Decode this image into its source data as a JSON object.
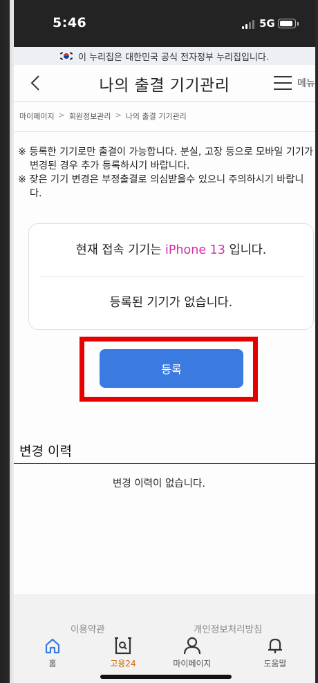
{
  "status_bar": {
    "time": "5:46",
    "network": "5G"
  },
  "gov_banner": {
    "text": "이 누리집은 대한민국 공식 전자정부 누리집입니다."
  },
  "header": {
    "title": "나의 출결 기기관리",
    "menu_label": "메뉴"
  },
  "breadcrumb": [
    "마이페이지",
    "회원정보관리",
    "나의 출결 기기관리"
  ],
  "breadcrumb_separator": ">",
  "notices": [
    "※ 등록한 기기로만 출결이 가능합니다. 분실, 고장 등으로 모바일 기기가 변경된 경우 추가 등록하시기 바랍니다.",
    "※ 잦은 기기 변경은 부정출결로 의심받을수 있으니 주의하시기 바랍니다."
  ],
  "device_card": {
    "current_prefix": "현재 접속 기기는 ",
    "current_model": "iPhone 13",
    "current_suffix": " 입니다.",
    "registered_empty": "등록된 기기가 없습니다."
  },
  "register_button": {
    "label": "등록"
  },
  "history": {
    "title": "변경 이력",
    "empty": "변경 이력이 없습니다."
  },
  "footer": {
    "terms": "이용약관",
    "privacy": "개인정보처리방침"
  },
  "tabs": [
    {
      "label": "홈",
      "icon": "home-icon"
    },
    {
      "label": "고용24",
      "icon": "search-document-icon"
    },
    {
      "label": "마이페이지",
      "icon": "person-icon"
    },
    {
      "label": "도움말",
      "icon": "bell-icon"
    }
  ],
  "colors": {
    "accent_blue": "#3b7ae0",
    "device_model": "#d62ba5",
    "highlight": "#e60000",
    "tab_active": "#c96a00"
  }
}
